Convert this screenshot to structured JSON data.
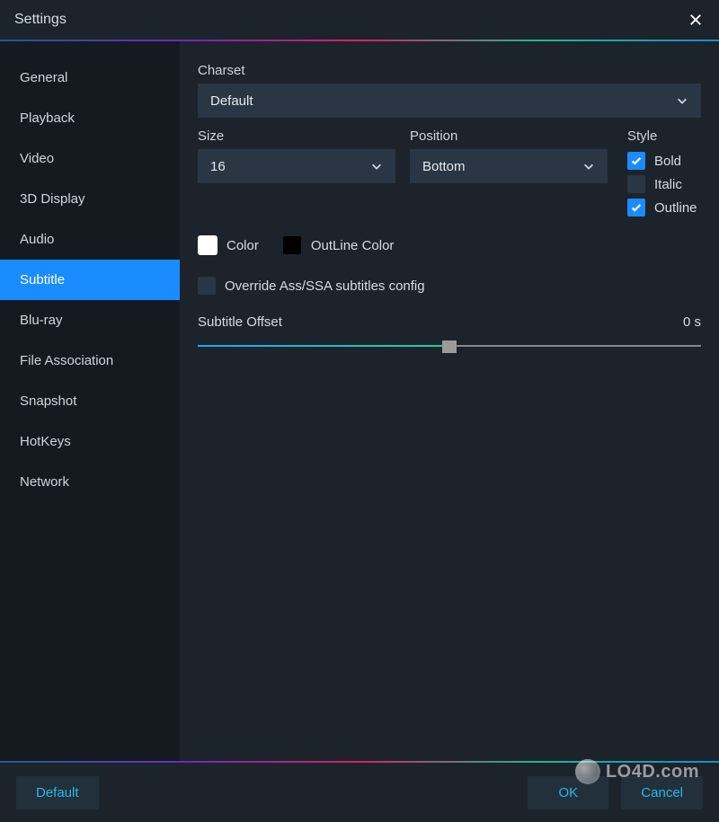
{
  "window": {
    "title": "Settings"
  },
  "sidebar": {
    "items": [
      {
        "label": "General"
      },
      {
        "label": "Playback"
      },
      {
        "label": "Video"
      },
      {
        "label": "3D Display"
      },
      {
        "label": "Audio"
      },
      {
        "label": "Subtitle",
        "selected": true
      },
      {
        "label": "Blu-ray"
      },
      {
        "label": "File Association"
      },
      {
        "label": "Snapshot"
      },
      {
        "label": "HotKeys"
      },
      {
        "label": "Network"
      }
    ]
  },
  "subtitle": {
    "charset_label": "Charset",
    "charset_value": "Default",
    "size_label": "Size",
    "size_value": "16",
    "position_label": "Position",
    "position_value": "Bottom",
    "style_label": "Style",
    "style": {
      "bold": {
        "label": "Bold",
        "checked": true
      },
      "italic": {
        "label": "Italic",
        "checked": false
      },
      "outline": {
        "label": "Outline",
        "checked": true
      }
    },
    "color_label": "Color",
    "outline_color_label": "OutLine Color",
    "override_label": "Override Ass/SSA subtitles config",
    "override_checked": false,
    "offset_label": "Subtitle Offset",
    "offset_value": "0 s"
  },
  "footer": {
    "default": "Default",
    "ok": "OK",
    "cancel": "Cancel"
  },
  "watermark": "LO4D.com"
}
